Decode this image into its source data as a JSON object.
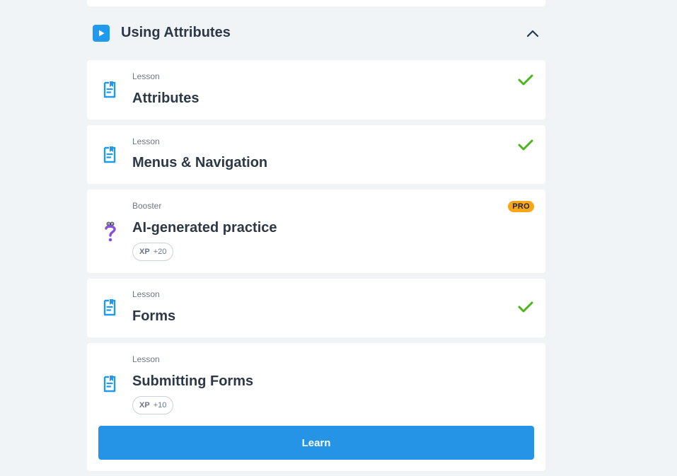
{
  "section": {
    "title": "Using Attributes",
    "icons": {
      "play": "play-icon",
      "collapse": "chevron-up-icon"
    }
  },
  "items": [
    {
      "type": "Lesson",
      "name": "Attributes",
      "status": "completed"
    },
    {
      "type": "Lesson",
      "name": "Menus & Navigation",
      "status": "completed"
    },
    {
      "type": "Booster",
      "name": "AI-generated practice",
      "badge": "PRO",
      "xp_label": "XP",
      "xp_value": "+20"
    },
    {
      "type": "Lesson",
      "name": "Forms",
      "status": "completed"
    },
    {
      "type": "Lesson",
      "name": "Submitting Forms",
      "xp_label": "XP",
      "xp_value": "+10",
      "action": "Learn"
    }
  ],
  "colors": {
    "background": "#f1f4f7",
    "accent_blue": "#2593e6",
    "icon_blue": "#1e9bf0",
    "check_green": "#4cb51c",
    "pro_orange": "#f6a61a",
    "booster_purple": "#8a4fd8"
  }
}
